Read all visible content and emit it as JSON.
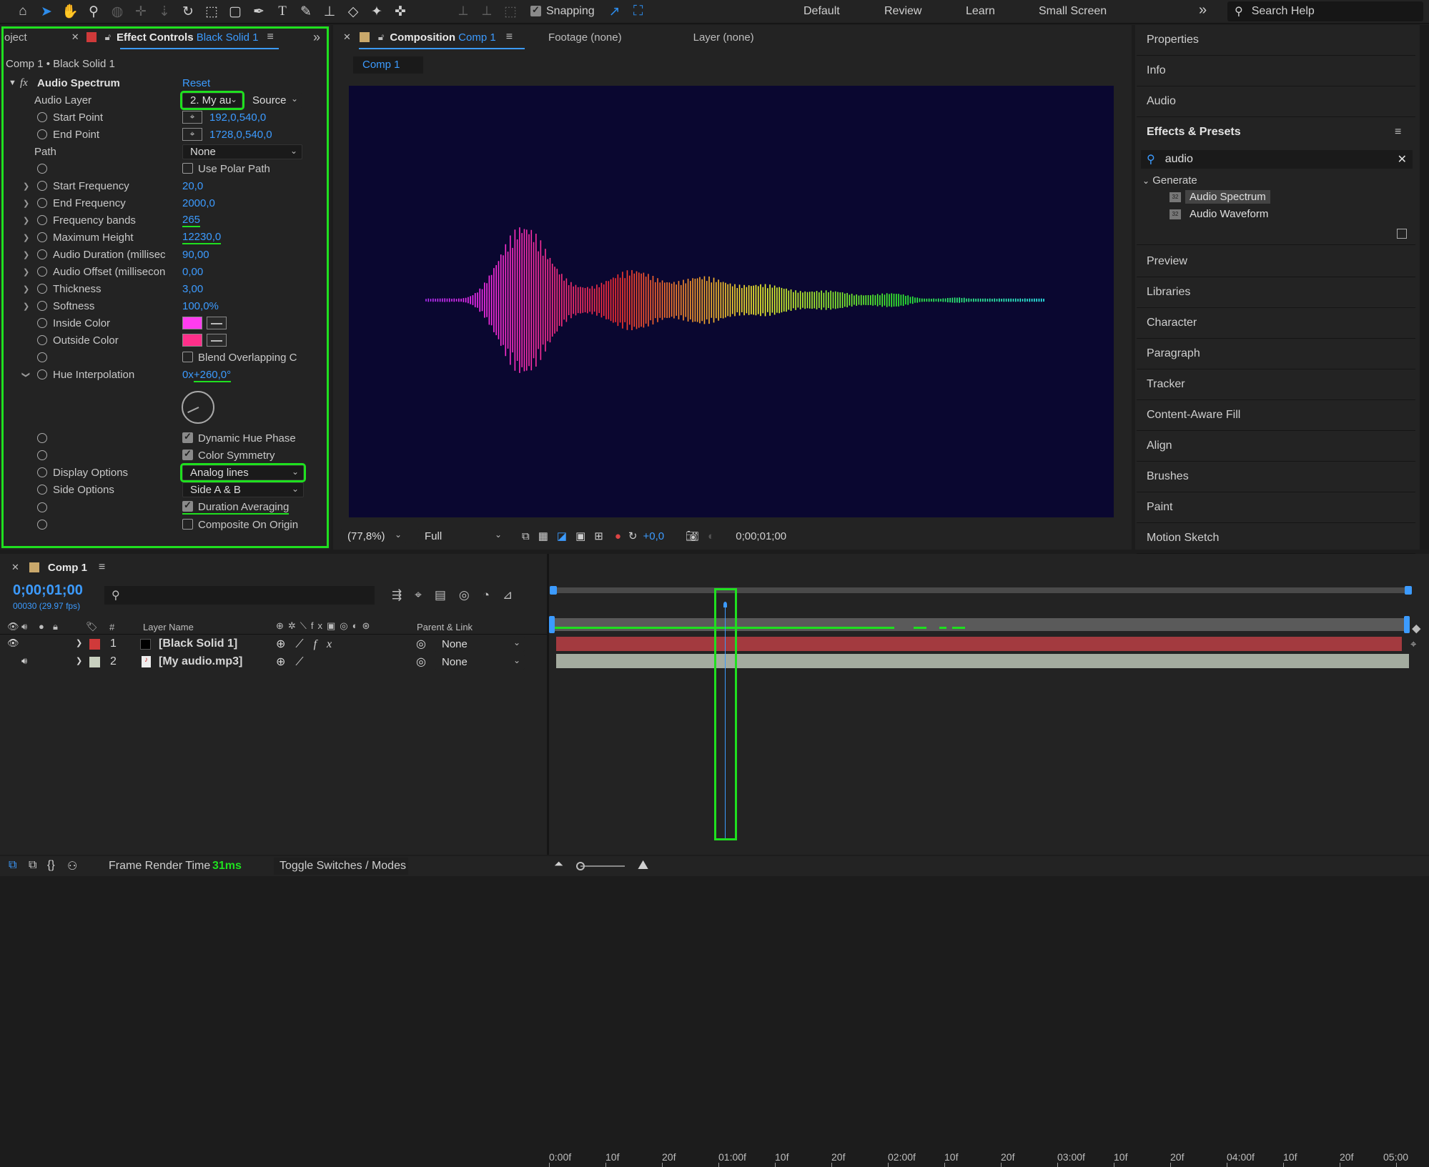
{
  "toolbar": {
    "snapping_label": "Snapping",
    "workspaces": [
      "Default",
      "Review",
      "Learn",
      "Small Screen"
    ],
    "more_icon": "»",
    "search_help": "Search Help"
  },
  "effect_controls": {
    "project_tab": "oject",
    "tab_title": "Effect Controls",
    "tab_layer": "Black Solid 1",
    "breadcrumb": "Comp 1 • Black Solid 1",
    "effect_name": "Audio Spectrum",
    "reset_label": "Reset",
    "audio_layer_label": "Audio Layer",
    "audio_layer_value": "2. My au",
    "source_value": "Source",
    "start_point_label": "Start Point",
    "start_point_value": "192,0,540,0",
    "end_point_label": "End Point",
    "end_point_value": "1728,0,540,0",
    "path_label": "Path",
    "path_value": "None",
    "use_polar_path": "Use Polar Path",
    "start_freq_label": "Start Frequency",
    "start_freq_value": "20,0",
    "end_freq_label": "End Frequency",
    "end_freq_value": "2000,0",
    "freq_bands_label": "Frequency bands",
    "freq_bands_value": "265",
    "max_height_label": "Maximum Height",
    "max_height_value": "12230,0",
    "audio_duration_label": "Audio Duration (millisec",
    "audio_duration_value": "90,00",
    "audio_offset_label": "Audio Offset (millisecon",
    "audio_offset_value": "0,00",
    "thickness_label": "Thickness",
    "thickness_value": "3,00",
    "softness_label": "Softness",
    "softness_value": "100,0%",
    "inside_color_label": "Inside Color",
    "inside_color": "#ff3cf0",
    "outside_color_label": "Outside Color",
    "outside_color": "#ff2f8a",
    "blend_label": "Blend Overlapping C",
    "hue_interp_label": "Hue Interpolation",
    "hue_prefix": "0x",
    "hue_value": "+260,0°",
    "dynamic_hue_label": "Dynamic Hue Phase",
    "color_symmetry_label": "Color Symmetry",
    "display_options_label": "Display Options",
    "display_options_value": "Analog lines",
    "side_options_label": "Side Options",
    "side_options_value": "Side A & B",
    "duration_avg_label": "Duration Averaging",
    "composite_origin_label": "Composite On Origin"
  },
  "composition": {
    "tab_title": "Composition",
    "tab_comp": "Comp 1",
    "footage_tab": "Footage (none)",
    "layer_tab": "Layer (none)",
    "subtab": "Comp 1",
    "zoom": "(77,8%)",
    "resolution": "Full",
    "exposure": "+0,0",
    "timecode": "0;00;01;00"
  },
  "right_panel": {
    "items_top": [
      "Properties",
      "Info",
      "Audio"
    ],
    "effects_presets_title": "Effects & Presets",
    "search_value": "audio",
    "category": "Generate",
    "results": [
      "Audio Spectrum",
      "Audio Waveform"
    ],
    "items_bottom": [
      "Preview",
      "Libraries",
      "Character",
      "Paragraph",
      "Tracker",
      "Content-Aware Fill",
      "Align",
      "Brushes",
      "Paint",
      "Motion Sketch"
    ]
  },
  "timeline": {
    "tab": "Comp 1",
    "timecode": "0;00;01;00",
    "fps": "00030 (29.97 fps)",
    "col_hash": "#",
    "col_layer_name": "Layer Name",
    "col_parent": "Parent & Link",
    "ticks": [
      "0:00f",
      "10f",
      "20f",
      "01:00f",
      "10f",
      "20f",
      "02:00f",
      "10f",
      "20f",
      "03:00f",
      "10f",
      "20f",
      "04:00f",
      "10f",
      "20f",
      "05:00"
    ],
    "layers": [
      {
        "num": "1",
        "name": "[Black Solid 1]",
        "parent": "None",
        "label_color": "#d03a3a",
        "bar_color": "#a33a3f"
      },
      {
        "num": "2",
        "name": "[My audio.mp3]",
        "parent": "None",
        "label_color": "#c8d0bf",
        "bar_color": "#a4ab9f"
      }
    ]
  },
  "status": {
    "frame_render_label": "Frame Render Time",
    "frame_render_value": "31ms",
    "toggle_label": "Toggle Switches / Modes"
  }
}
